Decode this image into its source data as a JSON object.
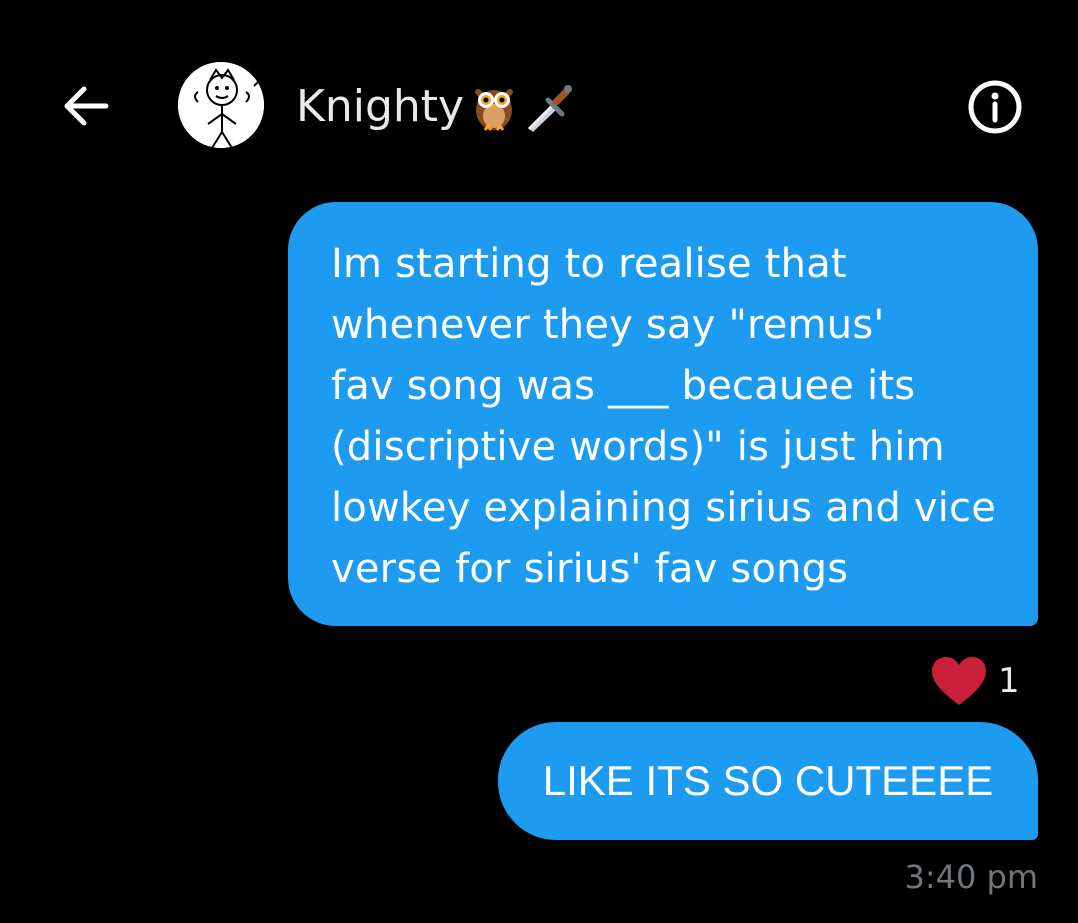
{
  "header": {
    "contact_name": "Knighty",
    "name_emojis": [
      "owl-icon",
      "dagger-icon"
    ],
    "back_icon": "arrow-left-icon",
    "info_icon": "info-icon"
  },
  "messages": [
    {
      "direction": "outgoing",
      "text": "Im starting to realise that\nwhenever they say \"remus'\nfav song was ___ becauee its\n(discriptive words)\" is just him\nlowkey explaining sirius and vice\nverse for sirius' fav songs",
      "reaction": {
        "icon": "heart-icon",
        "count": "1"
      }
    },
    {
      "direction": "outgoing",
      "text": "LIKE ITS SO CUTEEEE"
    }
  ],
  "timestamp": "3:40 pm",
  "colors": {
    "background": "#000000",
    "bubble": "#1d9bf0",
    "heart": "#e0245e",
    "muted_text": "#71767b"
  }
}
